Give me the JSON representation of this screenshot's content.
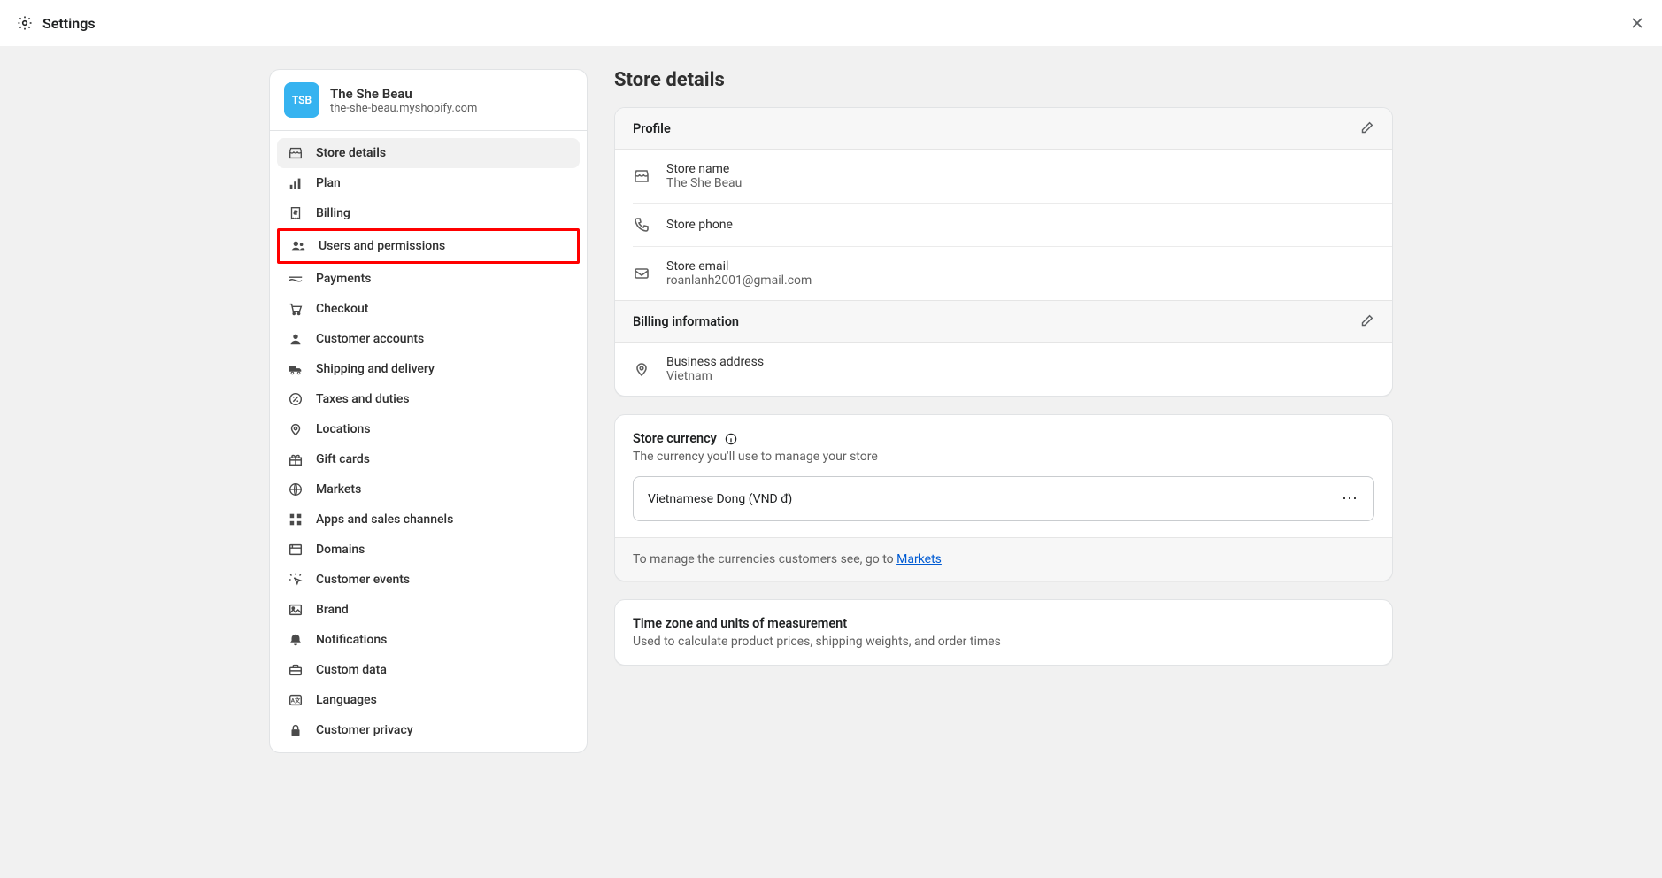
{
  "topbar": {
    "title": "Settings"
  },
  "store": {
    "avatar_text": "TSB",
    "name": "The She Beau",
    "url": "the-she-beau.myshopify.com"
  },
  "nav": {
    "items": [
      {
        "label": "Store details"
      },
      {
        "label": "Plan"
      },
      {
        "label": "Billing"
      },
      {
        "label": "Users and permissions"
      },
      {
        "label": "Payments"
      },
      {
        "label": "Checkout"
      },
      {
        "label": "Customer accounts"
      },
      {
        "label": "Shipping and delivery"
      },
      {
        "label": "Taxes and duties"
      },
      {
        "label": "Locations"
      },
      {
        "label": "Gift cards"
      },
      {
        "label": "Markets"
      },
      {
        "label": "Apps and sales channels"
      },
      {
        "label": "Domains"
      },
      {
        "label": "Customer events"
      },
      {
        "label": "Brand"
      },
      {
        "label": "Notifications"
      },
      {
        "label": "Custom data"
      },
      {
        "label": "Languages"
      },
      {
        "label": "Customer privacy"
      }
    ]
  },
  "page": {
    "title": "Store details"
  },
  "profile": {
    "header": "Profile",
    "name_label": "Store name",
    "name_value": "The She Beau",
    "phone_label": "Store phone",
    "email_label": "Store email",
    "email_value": "roanlanh2001@gmail.com"
  },
  "billing": {
    "header": "Billing information",
    "address_label": "Business address",
    "address_value": "Vietnam"
  },
  "currency": {
    "title": "Store currency",
    "desc": "The currency you'll use to manage your store",
    "value": "Vietnamese Dong (VND ₫)",
    "footer_prefix": "To manage the currencies customers see, go to ",
    "footer_link": "Markets"
  },
  "timezone": {
    "title": "Time zone and units of measurement",
    "desc": "Used to calculate product prices, shipping weights, and order times"
  }
}
